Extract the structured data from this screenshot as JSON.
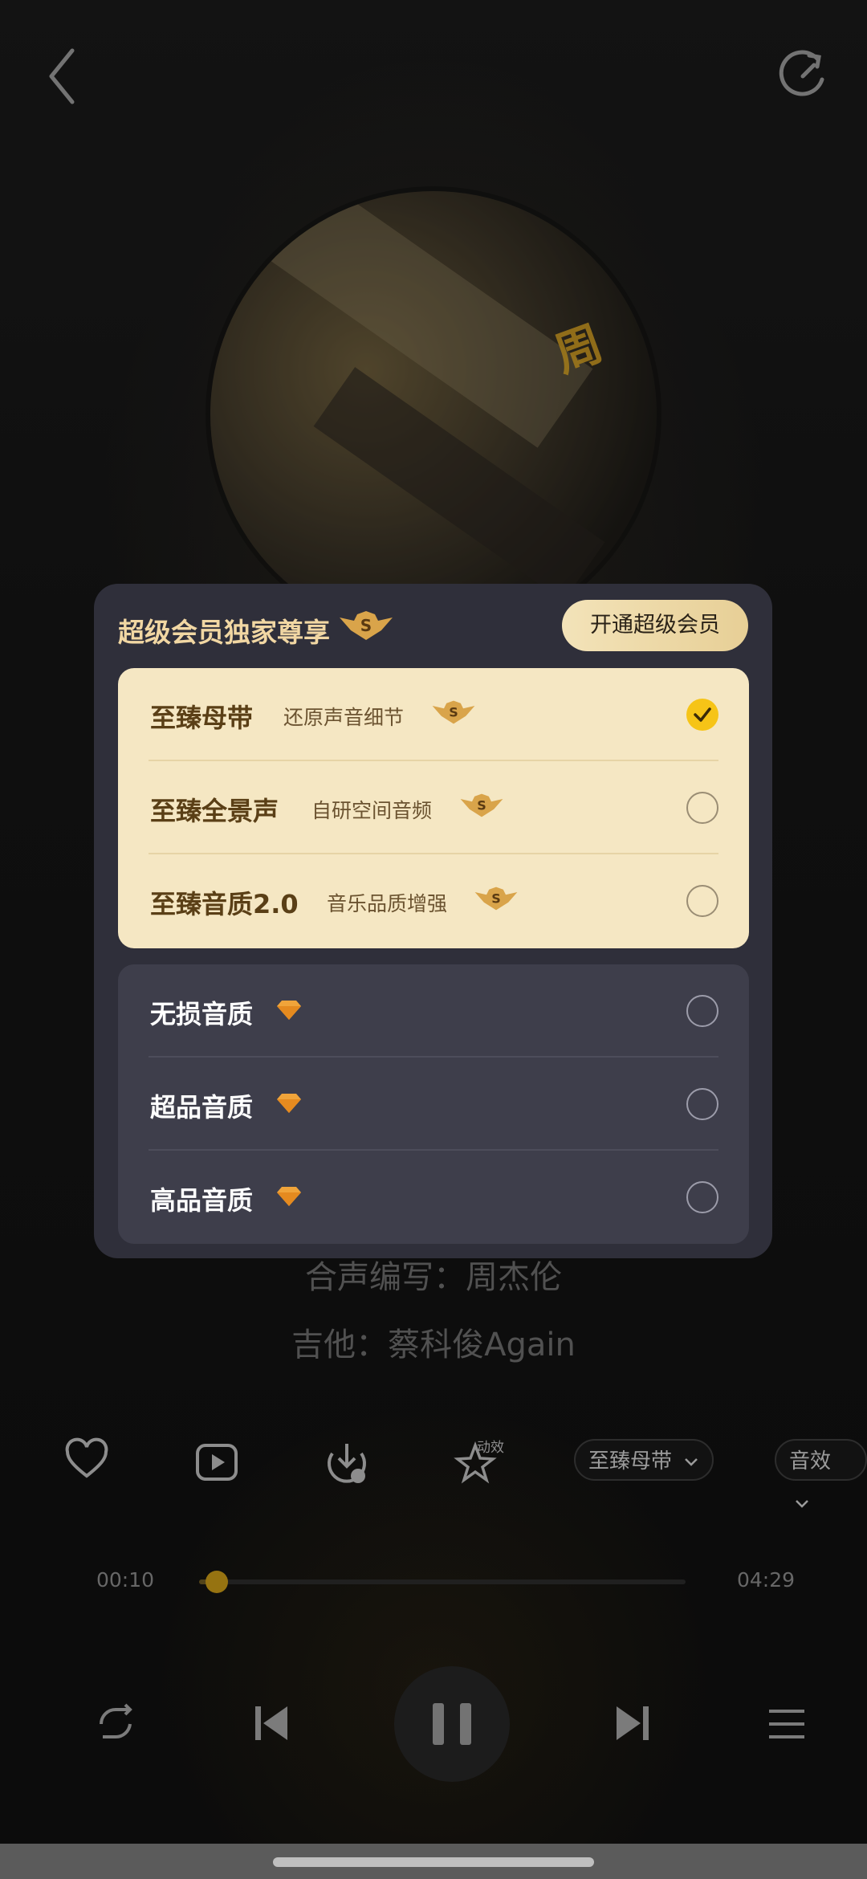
{
  "colors": {
    "accent": "#f6c417",
    "sheet_bg": "#2f2f3a",
    "gold_group": "#f5e7c3",
    "dark_group": "#3e3e4b"
  },
  "header": {
    "back_icon": "back-icon",
    "refresh_icon": "refresh-icon"
  },
  "lyrics": {
    "line1": "合声编写：周杰伦",
    "line2": "吉他：蔡科俊Again"
  },
  "toolbar": {
    "quality_pill": "至臻母带",
    "effects_pill": "音效",
    "effect_badge": "动效"
  },
  "progress": {
    "current": "00:10",
    "total": "04:29",
    "fraction": 0.037
  },
  "sheet": {
    "title": "超级会员独家尊享",
    "open_button": "开通超级会员",
    "premium_options": [
      {
        "name": "至臻母带",
        "desc": "还原声音细节",
        "selected": true
      },
      {
        "name": "至臻全景声",
        "desc": "自研空间音频",
        "selected": false
      },
      {
        "name": "至臻音质2.0",
        "desc": "音乐品质增强",
        "selected": false
      }
    ],
    "standard_options": [
      {
        "name": "无损音质",
        "selected": false
      },
      {
        "name": "超品音质",
        "selected": false
      },
      {
        "name": "高品音质",
        "selected": false
      }
    ]
  }
}
